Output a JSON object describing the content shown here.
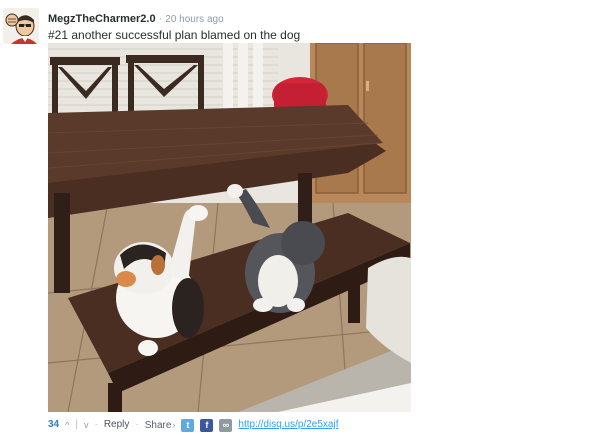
{
  "comment": {
    "username": "MegzTheCharmer2.0",
    "separator": "·",
    "timestamp": "20 hours ago",
    "message": "#21 another successful plan blamed on the dog",
    "avatar_icon": "cartoon-fist-avatar",
    "photo_icon": "cats-on-bench-photo"
  },
  "footer": {
    "votes": "34",
    "upvote_symbol": "^",
    "divider": "|",
    "downvote_symbol": "v",
    "dot": "·",
    "reply_label": "Reply",
    "share_label": "Share",
    "share_chevron": "›",
    "twitter_glyph": "t",
    "facebook_glyph": "f",
    "link_glyph": "∞",
    "permalink": "http://disq.us/p/2e5xajf",
    "colors": {
      "vote_count": "#2f7cc0",
      "twitter": "#5ea9dd",
      "facebook": "#3b5998",
      "link": "#8f9ba3",
      "url": "#2e9fff"
    }
  }
}
